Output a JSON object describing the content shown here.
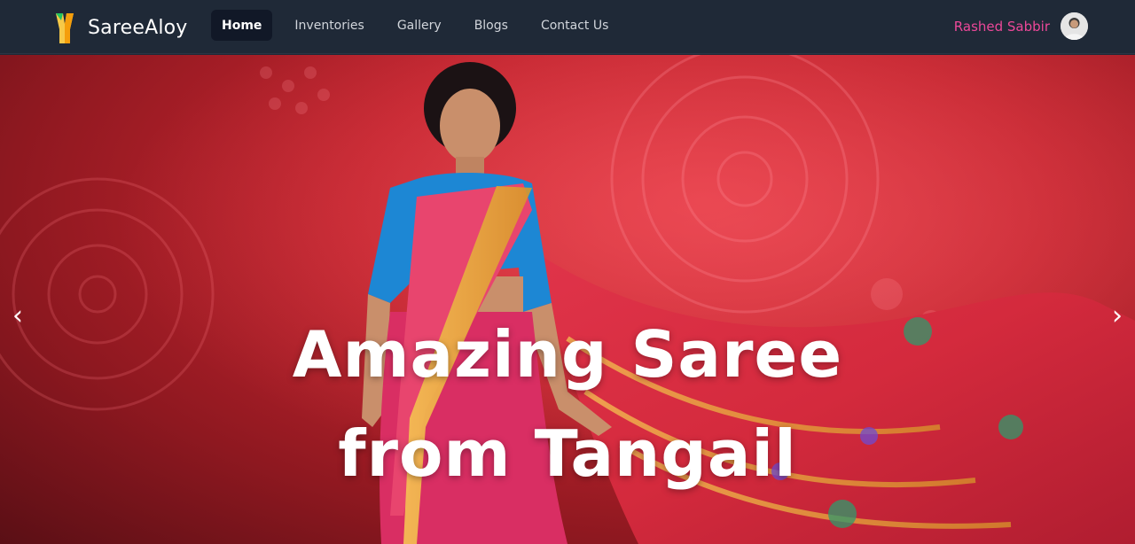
{
  "brand": {
    "name": "SareeAloy",
    "logo_icon": "saree-logo-icon"
  },
  "nav": {
    "items": [
      {
        "label": "Home",
        "active": true
      },
      {
        "label": "Inventories",
        "active": false
      },
      {
        "label": "Gallery",
        "active": false
      },
      {
        "label": "Blogs",
        "active": false
      },
      {
        "label": "Contact Us",
        "active": false
      }
    ]
  },
  "user": {
    "name": "Rashed Sabbir",
    "avatar_icon": "user-avatar"
  },
  "hero": {
    "caption_line1": "Amazing Saree",
    "caption_line2": "from Tangail",
    "prev_label": "‹",
    "next_label": "›",
    "image_subject": "woman-in-saree-photo"
  },
  "colors": {
    "nav_bg": "#1f2937",
    "active_bg": "#111827",
    "user_accent": "#ec4899",
    "hero_red": "#c2242e"
  }
}
